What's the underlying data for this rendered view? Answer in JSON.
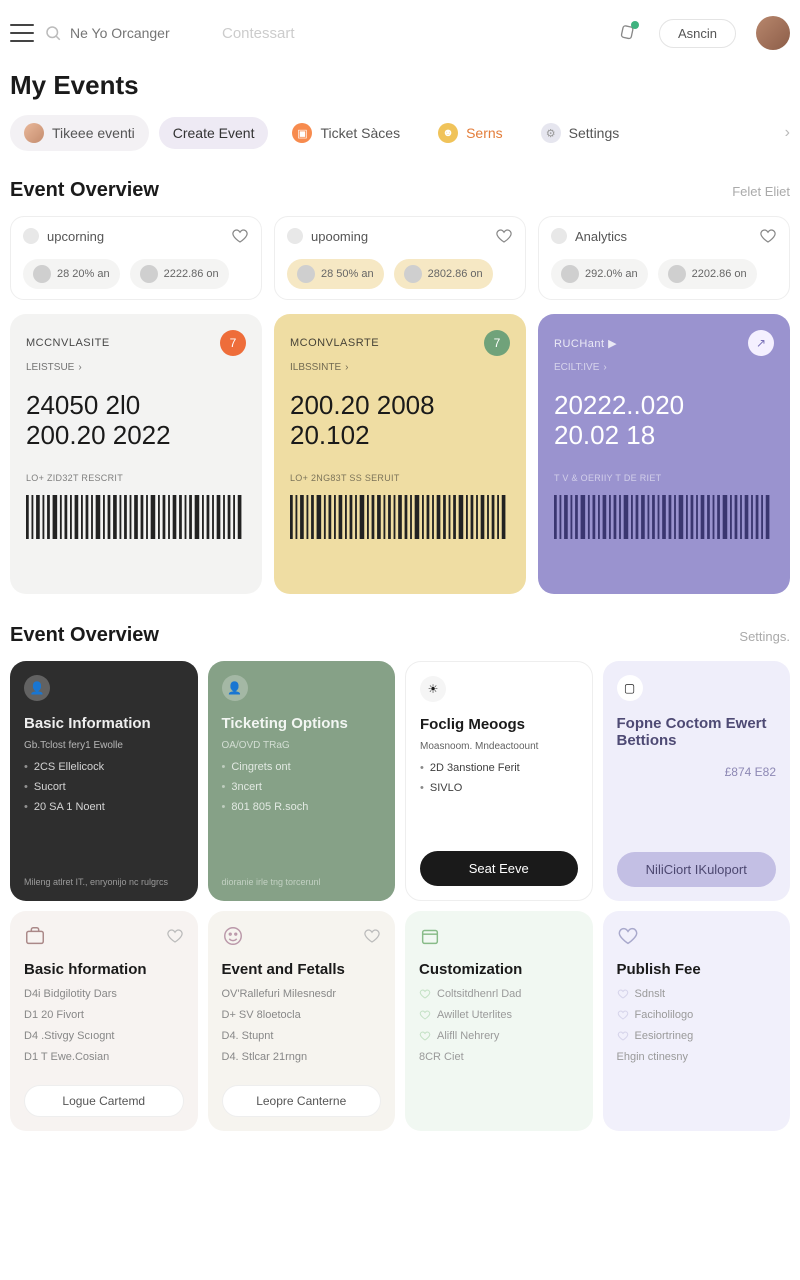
{
  "header": {
    "search_placeholder": "Ne Yo Orcanger",
    "search_secondary": "Contessart",
    "button": "Asncin"
  },
  "page_title": "My Events",
  "tabs": [
    {
      "label": "Tikeee eventi"
    },
    {
      "label": "Create Event"
    },
    {
      "label": "Ticket Sàces"
    },
    {
      "label": "Serns"
    },
    {
      "label": "Settings"
    }
  ],
  "section1": {
    "title": "Event Overview",
    "link": "Felet Eliet"
  },
  "ov_cards": [
    {
      "label": "upcorning",
      "chips": [
        {
          "txt": "28 20% an"
        },
        {
          "txt": "2222.86 on"
        }
      ]
    },
    {
      "label": "upooming",
      "chips": [
        {
          "txt": "28 50% an"
        },
        {
          "txt": "2802.86 on"
        }
      ]
    },
    {
      "label": "Analytics",
      "chips": [
        {
          "txt": "292.0% an"
        },
        {
          "txt": "2202.86 on"
        }
      ]
    }
  ],
  "tickets": [
    {
      "cat": "MCCNVLASITE",
      "badge": "7",
      "sub": "LEISTSUE",
      "line1": "24050 2l0",
      "line2": "200.20 2022",
      "foot": "LO+ ZID32T RESCRIT"
    },
    {
      "cat": "MCONVLASRTE",
      "badge": "7",
      "sub": "ILBSSINTE",
      "line1": "200.20 2008",
      "line2": "20.102",
      "foot": "LO+ 2NG83T SS SERUIT"
    },
    {
      "cat": "RUCHant ▶",
      "badge": "↗",
      "sub": "ECILT:IVE",
      "line1": "20222..020",
      "line2": "20.02 18",
      "foot": "T V & OERIIY T DE RIET"
    }
  ],
  "section2": {
    "title": "Event Overview",
    "link": "Settings."
  },
  "gcards": [
    {
      "title": "Basic Information",
      "sub": "Gb.Tclost fery1 Ewolle",
      "items": [
        "2CS Ellelicock",
        "Sucort",
        "20 SA 1 Noent"
      ],
      "foot": "Mileng atlret IT., enryonijo nc rulgrcs"
    },
    {
      "title": "Ticketing Options",
      "sub": "OA/OVD TRaG",
      "items": [
        "Cingrets ont",
        "3ncert",
        "801 805 R.soch"
      ],
      "foot": "dioranie irle tng torcerunl"
    },
    {
      "title": "Foclig Meoogs",
      "sub": "Moasnoom. Mndeactoount",
      "items": [
        "2D 3anstione Ferit",
        "SIVLO"
      ],
      "btn": "Seat Eeve"
    },
    {
      "title": "Fopne Coctom Ewert Bettions",
      "price": "£874 E82",
      "btn": "NiliCiort IKuloport"
    }
  ],
  "bcards": [
    {
      "title": "Basic hformation",
      "items": [
        "D4i Bidgilotity Dars",
        "D1 20 Fivort",
        "D4 .Stivgy Scıognt",
        "D1 T Ewe.Cosian"
      ],
      "btn": "Logue Cartemd"
    },
    {
      "title": "Event and Fetalls",
      "items": [
        "OV'Rallefuri Milesnesdr",
        "D+ SV 8loetocla",
        "D4. Stupnt",
        "D4. Stlcar 21rngn"
      ],
      "btn": "Leopre Canterne"
    },
    {
      "title": "Customization",
      "items": [
        "Coltsitdhenrl Dad",
        "Awillet Uterlites",
        "Alifll Nehrery",
        "8CR Ciet"
      ]
    },
    {
      "title": "Publish Fee",
      "items": [
        "Sdnslt",
        "Faciholilogo",
        "Eesiortrineg",
        "Ehgin ctinesny"
      ]
    }
  ]
}
